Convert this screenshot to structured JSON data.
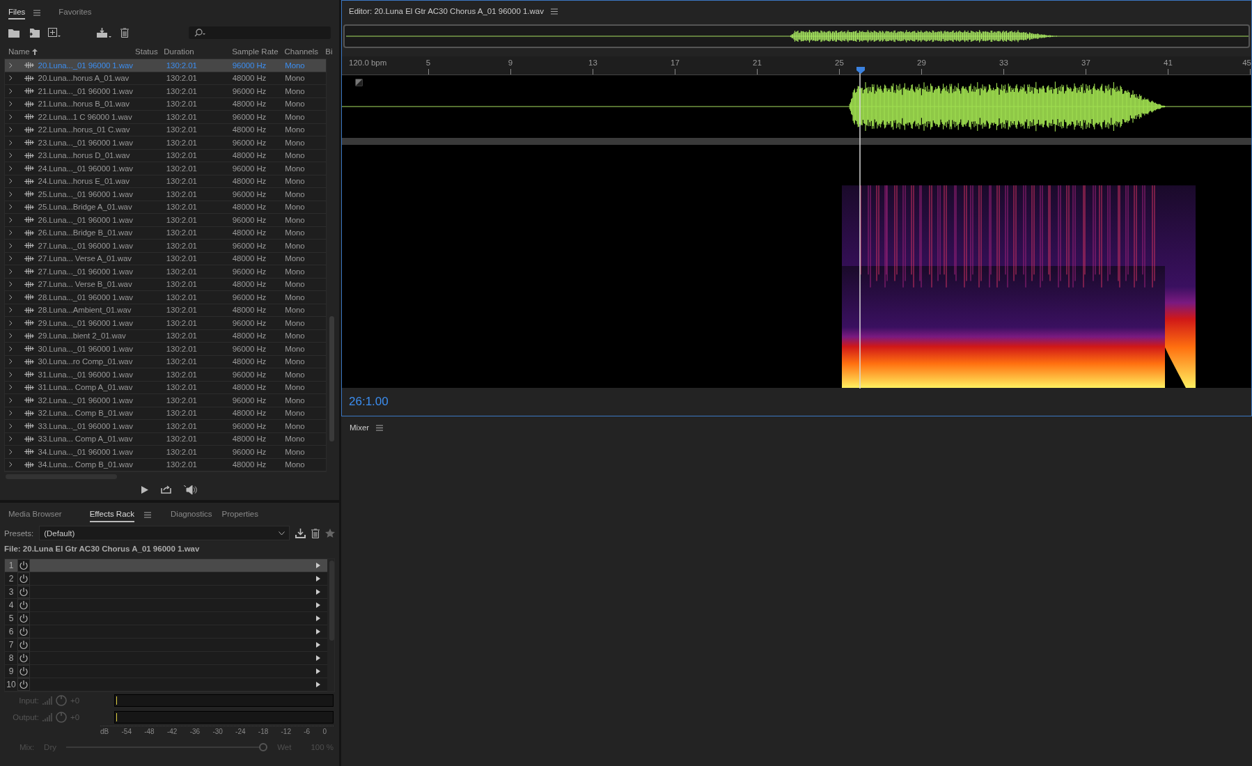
{
  "files_panel": {
    "tabs": [
      {
        "label": "Files",
        "selected": true
      },
      {
        "label": "Favorites",
        "selected": false
      }
    ],
    "columns": [
      "Name",
      "Status",
      "Duration",
      "Sample Rate",
      "Channels",
      "Bi"
    ],
    "rows": [
      {
        "name": "20.Luna..._01 96000 1.wav",
        "duration": "130:2.01",
        "sample_rate": "96000 Hz",
        "channels": "Mono",
        "selected": true
      },
      {
        "name": "20.Luna...horus A_01.wav",
        "duration": "130:2.01",
        "sample_rate": "48000 Hz",
        "channels": "Mono",
        "selected": false
      },
      {
        "name": "21.Luna..._01 96000 1.wav",
        "duration": "130:2.01",
        "sample_rate": "96000 Hz",
        "channels": "Mono",
        "selected": false
      },
      {
        "name": "21.Luna...horus B_01.wav",
        "duration": "130:2.01",
        "sample_rate": "48000 Hz",
        "channels": "Mono",
        "selected": false
      },
      {
        "name": "22.Luna...1 C 96000 1.wav",
        "duration": "130:2.01",
        "sample_rate": "96000 Hz",
        "channels": "Mono",
        "selected": false
      },
      {
        "name": "22.Luna...horus_01 C.wav",
        "duration": "130:2.01",
        "sample_rate": "48000 Hz",
        "channels": "Mono",
        "selected": false
      },
      {
        "name": "23.Luna..._01 96000 1.wav",
        "duration": "130:2.01",
        "sample_rate": "96000 Hz",
        "channels": "Mono",
        "selected": false
      },
      {
        "name": "23.Luna...horus D_01.wav",
        "duration": "130:2.01",
        "sample_rate": "48000 Hz",
        "channels": "Mono",
        "selected": false
      },
      {
        "name": "24.Luna..._01 96000 1.wav",
        "duration": "130:2.01",
        "sample_rate": "96000 Hz",
        "channels": "Mono",
        "selected": false
      },
      {
        "name": "24.Luna...horus E_01.wav",
        "duration": "130:2.01",
        "sample_rate": "48000 Hz",
        "channels": "Mono",
        "selected": false
      },
      {
        "name": "25.Luna..._01 96000 1.wav",
        "duration": "130:2.01",
        "sample_rate": "96000 Hz",
        "channels": "Mono",
        "selected": false
      },
      {
        "name": "25.Luna...Bridge A_01.wav",
        "duration": "130:2.01",
        "sample_rate": "48000 Hz",
        "channels": "Mono",
        "selected": false
      },
      {
        "name": "26.Luna..._01 96000 1.wav",
        "duration": "130:2.01",
        "sample_rate": "96000 Hz",
        "channels": "Mono",
        "selected": false
      },
      {
        "name": "26.Luna...Bridge B_01.wav",
        "duration": "130:2.01",
        "sample_rate": "48000 Hz",
        "channels": "Mono",
        "selected": false
      },
      {
        "name": "27.Luna..._01 96000 1.wav",
        "duration": "130:2.01",
        "sample_rate": "96000 Hz",
        "channels": "Mono",
        "selected": false
      },
      {
        "name": "27.Luna... Verse A_01.wav",
        "duration": "130:2.01",
        "sample_rate": "48000 Hz",
        "channels": "Mono",
        "selected": false
      },
      {
        "name": "27.Luna..._01 96000 1.wav",
        "duration": "130:2.01",
        "sample_rate": "96000 Hz",
        "channels": "Mono",
        "selected": false
      },
      {
        "name": "27.Luna... Verse B_01.wav",
        "duration": "130:2.01",
        "sample_rate": "48000 Hz",
        "channels": "Mono",
        "selected": false
      },
      {
        "name": "28.Luna..._01 96000 1.wav",
        "duration": "130:2.01",
        "sample_rate": "96000 Hz",
        "channels": "Mono",
        "selected": false
      },
      {
        "name": "28.Luna...Ambient_01.wav",
        "duration": "130:2.01",
        "sample_rate": "48000 Hz",
        "channels": "Mono",
        "selected": false
      },
      {
        "name": "29.Luna..._01 96000 1.wav",
        "duration": "130:2.01",
        "sample_rate": "96000 Hz",
        "channels": "Mono",
        "selected": false
      },
      {
        "name": "29.Luna...bient 2_01.wav",
        "duration": "130:2.01",
        "sample_rate": "48000 Hz",
        "channels": "Mono",
        "selected": false
      },
      {
        "name": "30.Luna..._01 96000 1.wav",
        "duration": "130:2.01",
        "sample_rate": "96000 Hz",
        "channels": "Mono",
        "selected": false
      },
      {
        "name": "30.Luna...ro Comp_01.wav",
        "duration": "130:2.01",
        "sample_rate": "48000 Hz",
        "channels": "Mono",
        "selected": false
      },
      {
        "name": "31.Luna..._01 96000 1.wav",
        "duration": "130:2.01",
        "sample_rate": "96000 Hz",
        "channels": "Mono",
        "selected": false
      },
      {
        "name": "31.Luna... Comp A_01.wav",
        "duration": "130:2.01",
        "sample_rate": "48000 Hz",
        "channels": "Mono",
        "selected": false
      },
      {
        "name": "32.Luna..._01 96000 1.wav",
        "duration": "130:2.01",
        "sample_rate": "96000 Hz",
        "channels": "Mono",
        "selected": false
      },
      {
        "name": "32.Luna... Comp B_01.wav",
        "duration": "130:2.01",
        "sample_rate": "48000 Hz",
        "channels": "Mono",
        "selected": false
      },
      {
        "name": "33.Luna..._01 96000 1.wav",
        "duration": "130:2.01",
        "sample_rate": "96000 Hz",
        "channels": "Mono",
        "selected": false
      },
      {
        "name": "33.Luna... Comp A_01.wav",
        "duration": "130:2.01",
        "sample_rate": "48000 Hz",
        "channels": "Mono",
        "selected": false
      },
      {
        "name": "34.Luna..._01 96000 1.wav",
        "duration": "130:2.01",
        "sample_rate": "96000 Hz",
        "channels": "Mono",
        "selected": false
      },
      {
        "name": "34.Luna... Comp B_01.wav",
        "duration": "130:2.01",
        "sample_rate": "48000 Hz",
        "channels": "Mono",
        "selected": false
      }
    ]
  },
  "effects_panel": {
    "tabs": [
      {
        "label": "Media Browser",
        "selected": false
      },
      {
        "label": "Effects Rack",
        "selected": true
      },
      {
        "label": "Diagnostics",
        "selected": false
      },
      {
        "label": "Properties",
        "selected": false
      }
    ],
    "presets_label": "Presets:",
    "preset": "(Default)",
    "file_label": "File: 20.Luna El Gtr AC30 Chorus A_01 96000 1.wav",
    "slots": [
      {
        "number": "1",
        "selected": true
      },
      {
        "number": "2",
        "selected": false
      },
      {
        "number": "3",
        "selected": false
      },
      {
        "number": "4",
        "selected": false
      },
      {
        "number": "5",
        "selected": false
      },
      {
        "number": "6",
        "selected": false
      },
      {
        "number": "7",
        "selected": false
      },
      {
        "number": "8",
        "selected": false
      },
      {
        "number": "9",
        "selected": false
      },
      {
        "number": "10",
        "selected": false
      }
    ],
    "meters": [
      {
        "label": "Input:",
        "gain": "+0"
      },
      {
        "label": "Output:",
        "gain": "+0"
      }
    ],
    "db_scale": [
      "dB",
      "-54",
      "-48",
      "-42",
      "-36",
      "-30",
      "-24",
      "-18",
      "-12",
      "-6",
      "0"
    ],
    "mix": {
      "label": "Mix:",
      "dry": "Dry",
      "wet": "Wet",
      "value": "100 %",
      "level": 1
    }
  },
  "editor": {
    "title": "Editor: 20.Luna El Gtr AC30 Chorus A_01 96000 1.wav",
    "tempo": "120.0 bpm",
    "ruler": [
      "5",
      "9",
      "13",
      "17",
      "21",
      "25",
      "29",
      "33",
      "37",
      "41",
      "45"
    ],
    "timecode": "26:1.00"
  },
  "mixer": {
    "title": "Mixer"
  }
}
